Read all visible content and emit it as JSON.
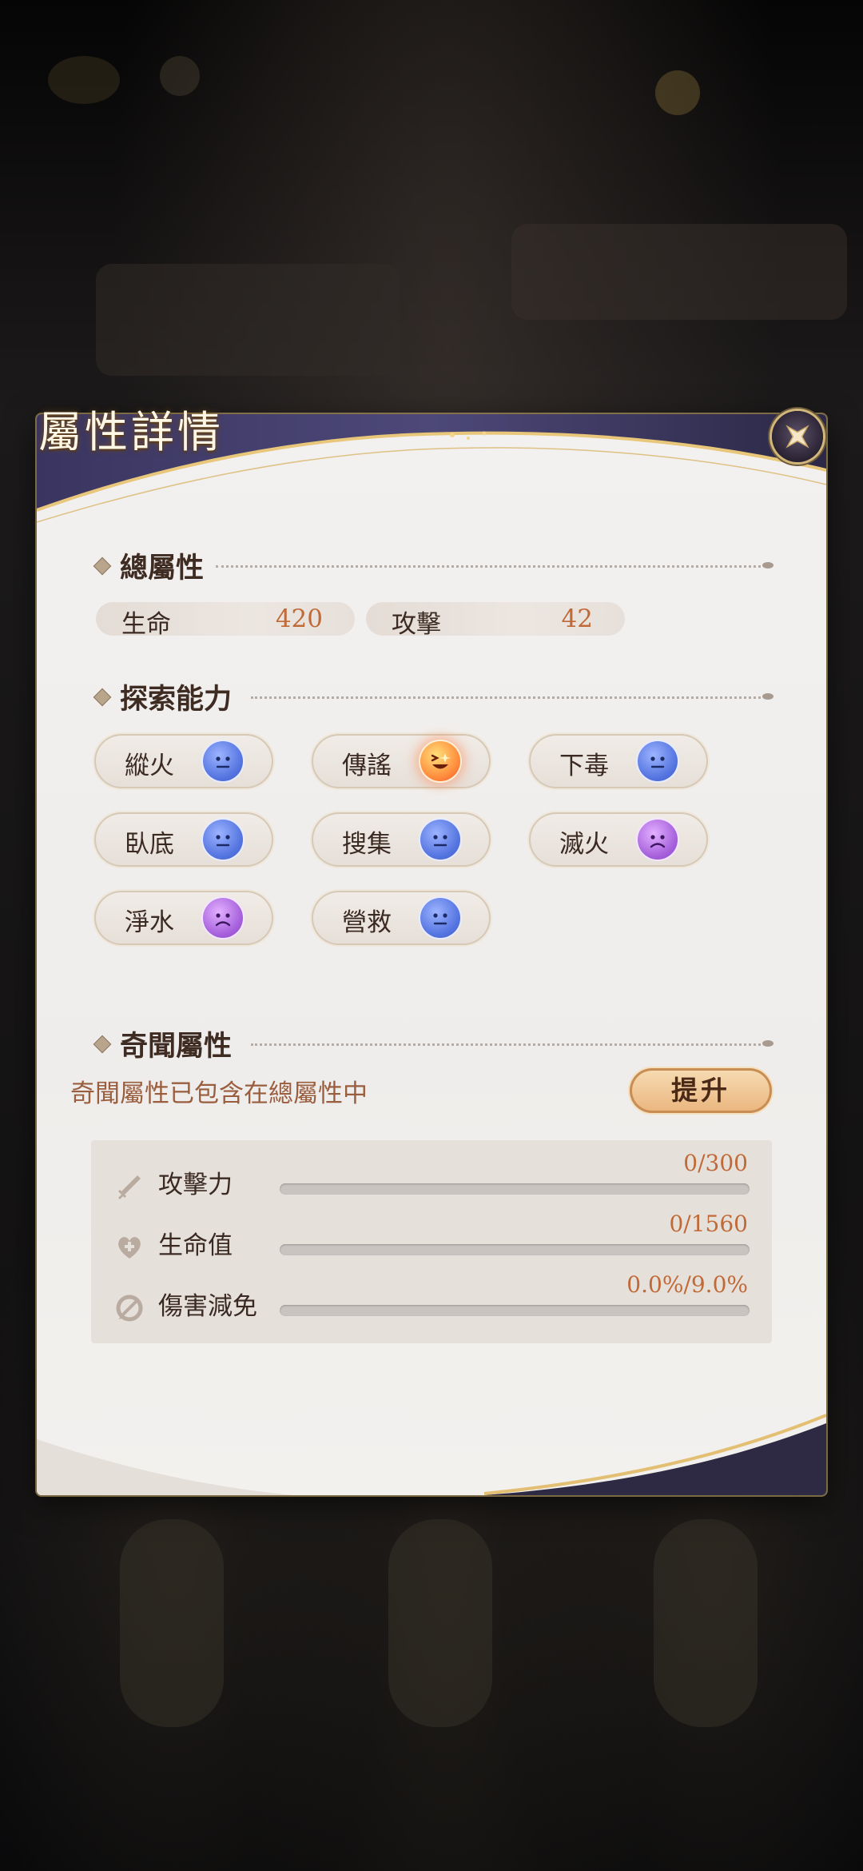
{
  "dialog": {
    "title": "屬性詳情"
  },
  "total_attributes": {
    "header": "總屬性",
    "stats": [
      {
        "label": "生命",
        "value": "420"
      },
      {
        "label": "攻擊",
        "value": "42"
      }
    ]
  },
  "exploration": {
    "header": "探索能力",
    "abilities": [
      {
        "label": "縱火",
        "mood": "neutral"
      },
      {
        "label": "傳謠",
        "mood": "happy"
      },
      {
        "label": "下毒",
        "mood": "neutral"
      },
      {
        "label": "臥底",
        "mood": "neutral"
      },
      {
        "label": "搜集",
        "mood": "neutral"
      },
      {
        "label": "滅火",
        "mood": "sad"
      },
      {
        "label": "淨水",
        "mood": "sad"
      },
      {
        "label": "營救",
        "mood": "neutral"
      }
    ]
  },
  "anecdote_attributes": {
    "header": "奇聞屬性",
    "info": "奇聞屬性已包含在總屬性中",
    "upgrade_label": "提升",
    "rows": [
      {
        "label": "攻擊力",
        "value": "0/300",
        "progress": 0.0,
        "icon": "sword-icon"
      },
      {
        "label": "生命值",
        "value": "0/1560",
        "progress": 0.0,
        "icon": "heart-plus-icon"
      },
      {
        "label": "傷害減免",
        "value": "0.0%/9.0%",
        "progress": 0.0,
        "icon": "damage-reduction-icon"
      }
    ]
  },
  "colors": {
    "accent": "#c06a38",
    "neutral_face": "#5474e0",
    "sad_face": "#a660dc",
    "happy_face": "#ff8a3b"
  }
}
